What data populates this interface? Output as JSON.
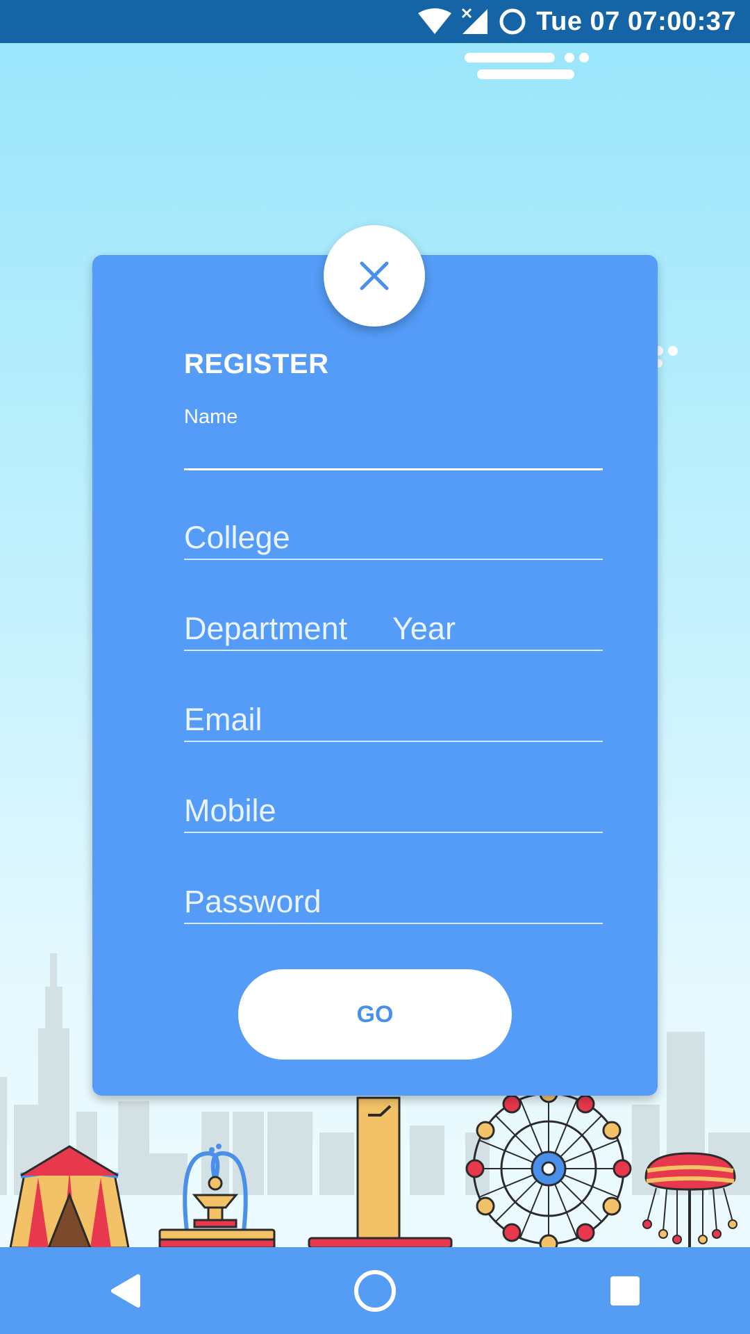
{
  "status_bar": {
    "time": "Tue 07 07:00:37",
    "icons": [
      "wifi-icon",
      "signal-no-data-icon",
      "sync-circle-icon"
    ]
  },
  "form": {
    "title": "REGISTER",
    "name_label": "Name",
    "name_value": "",
    "college_placeholder": "College",
    "department_placeholder": "Department",
    "year_placeholder": "Year",
    "email_placeholder": "Email",
    "mobile_placeholder": "Mobile",
    "password_placeholder": "Password",
    "go_label": "GO",
    "close_icon": "close-icon"
  },
  "nav_bar": {
    "icons": [
      "back-triangle-icon",
      "home-circle-icon",
      "recents-square-icon"
    ]
  },
  "colors": {
    "status_bar": "#1565a6",
    "card": "#549cf7",
    "accent": "#4a90ea",
    "nav_bar": "#559cf5"
  }
}
